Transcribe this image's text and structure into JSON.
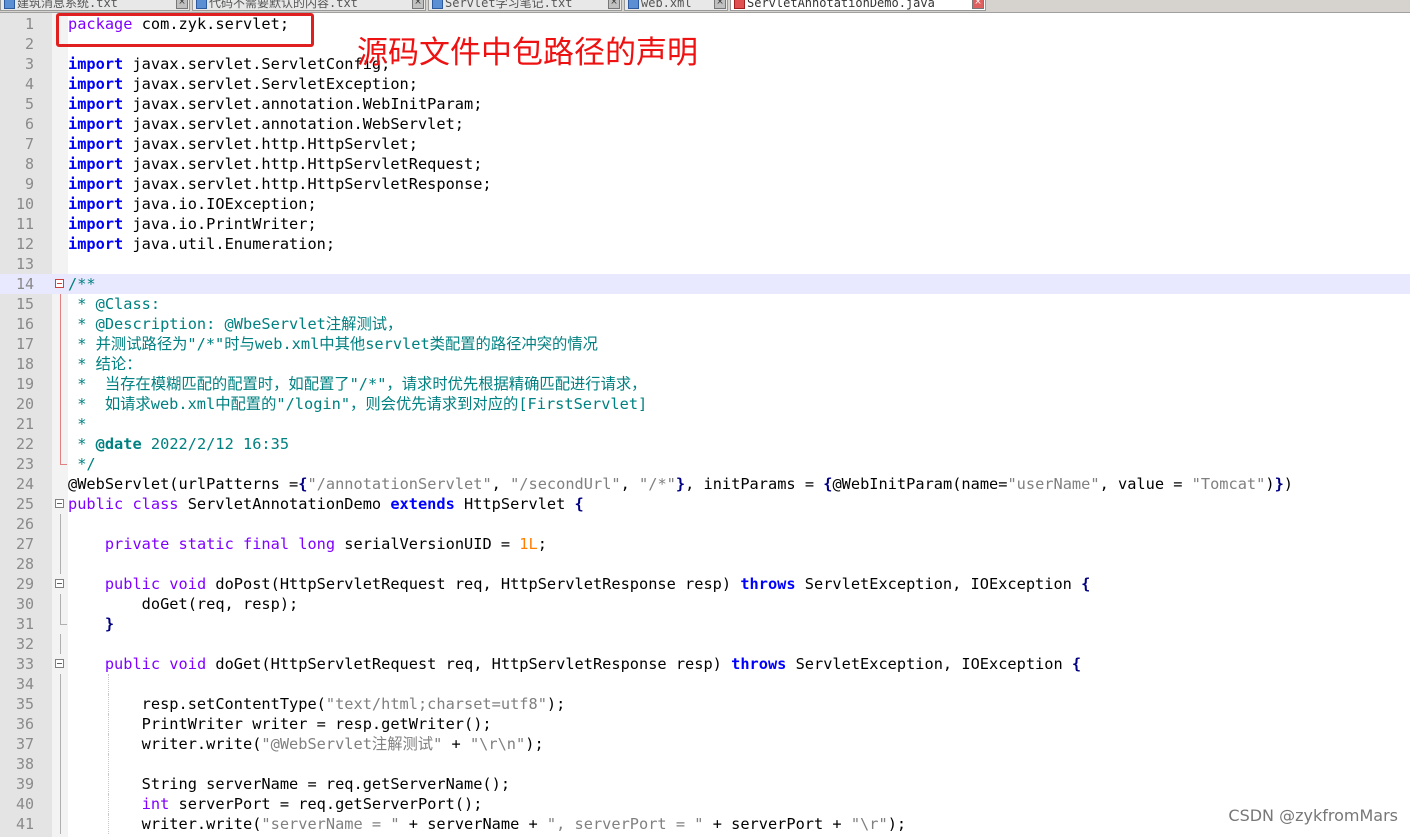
{
  "tabs": [
    {
      "label": "建筑消息系统.txt",
      "active": false
    },
    {
      "label": "代码不需要默认的内容.txt",
      "active": false
    },
    {
      "label": "Servlet学习笔记.txt",
      "active": false
    },
    {
      "label": "web.xml",
      "active": false
    },
    {
      "label": "ServletAnnotationDemo.java",
      "active": true
    }
  ],
  "annotation": "源码文件中包路径的声明",
  "watermark": "CSDN @zykfromMars",
  "lines": [
    {
      "n": "1",
      "segs": [
        [
          "kp",
          "package"
        ],
        [
          "",
          "com.zyk.servlet;"
        ]
      ]
    },
    {
      "n": "2",
      "segs": []
    },
    {
      "n": "3",
      "segs": [
        [
          "k",
          "import"
        ],
        [
          "",
          " javax.servlet.ServletConfig;"
        ]
      ]
    },
    {
      "n": "4",
      "segs": [
        [
          "k",
          "import"
        ],
        [
          "",
          " javax.servlet.ServletException;"
        ]
      ]
    },
    {
      "n": "5",
      "segs": [
        [
          "k",
          "import"
        ],
        [
          "",
          " javax.servlet.annotation.WebInitParam;"
        ]
      ]
    },
    {
      "n": "6",
      "segs": [
        [
          "k",
          "import"
        ],
        [
          "",
          " javax.servlet.annotation.WebServlet;"
        ]
      ]
    },
    {
      "n": "7",
      "segs": [
        [
          "k",
          "import"
        ],
        [
          "",
          " javax.servlet.http.HttpServlet;"
        ]
      ]
    },
    {
      "n": "8",
      "segs": [
        [
          "k",
          "import"
        ],
        [
          "",
          " javax.servlet.http.HttpServletRequest;"
        ]
      ]
    },
    {
      "n": "9",
      "segs": [
        [
          "k",
          "import"
        ],
        [
          "",
          " javax.servlet.http.HttpServletResponse;"
        ]
      ]
    },
    {
      "n": "10",
      "segs": [
        [
          "k",
          "import"
        ],
        [
          "",
          " java.io.IOException;"
        ]
      ]
    },
    {
      "n": "11",
      "segs": [
        [
          "k",
          "import"
        ],
        [
          "",
          " java.io.PrintWriter;"
        ]
      ]
    },
    {
      "n": "12",
      "segs": [
        [
          "k",
          "import"
        ],
        [
          "",
          " java.util.Enumeration;"
        ]
      ]
    },
    {
      "n": "13",
      "segs": []
    },
    {
      "n": "14",
      "segs": [
        [
          "c",
          "/**"
        ]
      ]
    },
    {
      "n": "15",
      "segs": [
        [
          "c",
          " * @Class:"
        ]
      ]
    },
    {
      "n": "16",
      "segs": [
        [
          "c",
          " * @Description: @WbeServlet注解测试，"
        ]
      ]
    },
    {
      "n": "17",
      "segs": [
        [
          "c",
          " * 并测试路径为\"/*\"时与web.xml中其他servlet类配置的路径冲突的情况"
        ]
      ]
    },
    {
      "n": "18",
      "segs": [
        [
          "c",
          " * 结论："
        ]
      ]
    },
    {
      "n": "19",
      "segs": [
        [
          "c",
          " *  当存在模糊匹配的配置时，如配置了\"/*\"，请求时优先根据精确匹配进行请求，"
        ]
      ]
    },
    {
      "n": "20",
      "segs": [
        [
          "c",
          " *  如请求web.xml中配置的\"/login\"，则会优先请求到对应的[FirstServlet]"
        ]
      ]
    },
    {
      "n": "21",
      "segs": [
        [
          "c",
          " *"
        ]
      ]
    },
    {
      "n": "22",
      "segs": [
        [
          "c",
          " * "
        ],
        [
          "ck",
          "@date"
        ],
        [
          "c",
          " 2022/2/12 16:35"
        ]
      ]
    },
    {
      "n": "23",
      "segs": [
        [
          "c",
          " */"
        ]
      ]
    },
    {
      "n": "24",
      "segs": [
        [
          "",
          "@WebServlet(urlPatterns ="
        ],
        [
          "o",
          "{"
        ],
        [
          "s",
          "\"/annotationServlet\""
        ],
        [
          "",
          ", "
        ],
        [
          "s",
          "\"/secondUrl\""
        ],
        [
          "",
          ", "
        ],
        [
          "s",
          "\"/*\""
        ],
        [
          "o",
          "}"
        ],
        [
          "",
          ", initParams = "
        ],
        [
          "o",
          "{"
        ],
        [
          "",
          "@WebInitParam(name="
        ],
        [
          "s",
          "\"userName\""
        ],
        [
          "",
          ", value = "
        ],
        [
          "s",
          "\"Tomcat\""
        ],
        [
          "",
          ")"
        ],
        [
          "o",
          "}"
        ],
        [
          "",
          ")"
        ]
      ]
    },
    {
      "n": "25",
      "segs": [
        [
          "kp",
          "public class"
        ],
        [
          "",
          " ServletAnnotationDemo "
        ],
        [
          "k",
          "extends"
        ],
        [
          "",
          " HttpServlet "
        ],
        [
          "o",
          "{"
        ]
      ]
    },
    {
      "n": "26",
      "segs": []
    },
    {
      "n": "27",
      "segs": [
        [
          "",
          "    "
        ],
        [
          "kp",
          "private static final long"
        ],
        [
          "",
          " serialVersionUID = "
        ],
        [
          "n",
          "1L"
        ],
        [
          "",
          ";"
        ]
      ]
    },
    {
      "n": "28",
      "segs": []
    },
    {
      "n": "29",
      "segs": [
        [
          "",
          "    "
        ],
        [
          "kp",
          "public void"
        ],
        [
          "",
          " doPost(HttpServletRequest req, HttpServletResponse resp) "
        ],
        [
          "k",
          "throws"
        ],
        [
          "",
          " ServletException, IOException "
        ],
        [
          "o",
          "{"
        ]
      ]
    },
    {
      "n": "30",
      "segs": [
        [
          "",
          "        doGet(req, resp);"
        ]
      ]
    },
    {
      "n": "31",
      "segs": [
        [
          "",
          "    "
        ],
        [
          "o",
          "}"
        ]
      ]
    },
    {
      "n": "32",
      "segs": []
    },
    {
      "n": "33",
      "segs": [
        [
          "",
          "    "
        ],
        [
          "kp",
          "public void"
        ],
        [
          "",
          " doGet(HttpServletRequest req, HttpServletResponse resp) "
        ],
        [
          "k",
          "throws"
        ],
        [
          "",
          " ServletException, IOException "
        ],
        [
          "o",
          "{"
        ]
      ]
    },
    {
      "n": "34",
      "segs": []
    },
    {
      "n": "35",
      "segs": [
        [
          "",
          "        resp.setContentType("
        ],
        [
          "s",
          "\"text/html;charset=utf8\""
        ],
        [
          "",
          ");"
        ]
      ]
    },
    {
      "n": "36",
      "segs": [
        [
          "",
          "        PrintWriter writer = resp.getWriter();"
        ]
      ]
    },
    {
      "n": "37",
      "segs": [
        [
          "",
          "        writer.write("
        ],
        [
          "s",
          "\"@WebServlet注解测试\""
        ],
        [
          "",
          " + "
        ],
        [
          "s",
          "\"\\r\\n\""
        ],
        [
          "",
          ");"
        ]
      ]
    },
    {
      "n": "38",
      "segs": []
    },
    {
      "n": "39",
      "segs": [
        [
          "",
          "        String serverName = req.getServerName();"
        ]
      ]
    },
    {
      "n": "40",
      "segs": [
        [
          "",
          "        "
        ],
        [
          "kp",
          "int"
        ],
        [
          "",
          " serverPort = req.getServerPort();"
        ]
      ]
    },
    {
      "n": "41",
      "segs": [
        [
          "",
          "        writer.write("
        ],
        [
          "s",
          "\"serverName = \""
        ],
        [
          "",
          " + serverName + "
        ],
        [
          "s",
          "\", serverPort = \""
        ],
        [
          "",
          " + serverPort + "
        ],
        [
          "s",
          "\"\\r\""
        ],
        [
          "",
          ");"
        ]
      ]
    }
  ]
}
